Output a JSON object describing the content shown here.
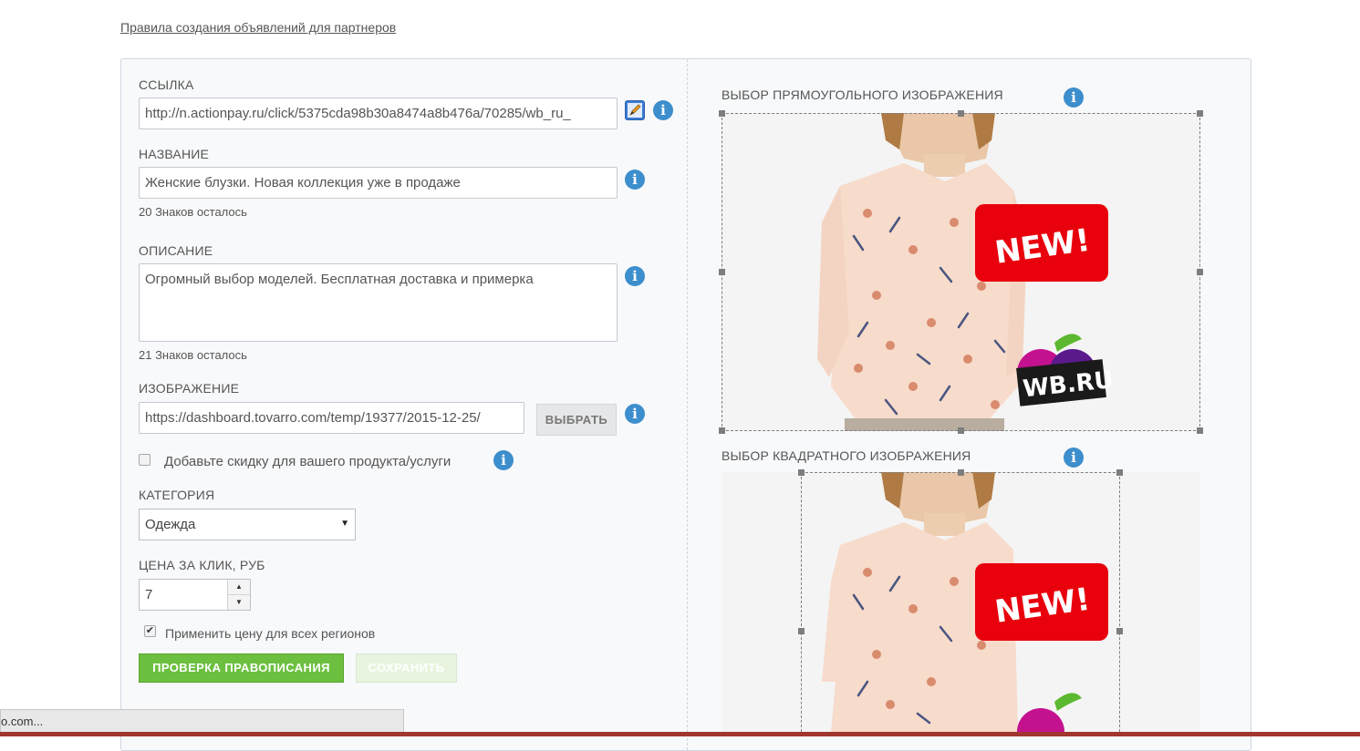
{
  "top_link": "Правила создания объявлений для партнеров",
  "form": {
    "link": {
      "label": "ССЫЛКА",
      "value": "http://n.actionpay.ru/click/5375cda98b30a8474a8b476a/70285/wb_ru_"
    },
    "title": {
      "label": "НАЗВАНИЕ",
      "value": "Женские блузки. Новая коллекция уже в продаже",
      "counter": "20 Знаков осталось"
    },
    "description": {
      "label": "ОПИСАНИЕ",
      "value": "Огромный выбор моделей. Бесплатная доставка и примерка",
      "counter": "21 Знаков осталось"
    },
    "image": {
      "label": "ИЗОБРАЖЕНИЕ",
      "value": "https://dashboard.tovarro.com/temp/19377/2015-12-25/",
      "choose_button": "ВЫБРАТЬ"
    },
    "discount_checkbox": {
      "label": "Добавьте скидку для вашего продукта/услуги",
      "checked": false
    },
    "category": {
      "label": "КАТЕГОРИЯ",
      "selected": "Одежда"
    },
    "price": {
      "label": "ЦЕНА ЗА КЛИК, РУБ",
      "value": "7"
    },
    "all_regions_checkbox": {
      "label": "Применить цену для всех регионов",
      "checked": true
    },
    "spellcheck_button": "ПРОВЕРКА ПРАВОПИСАНИЯ",
    "save_button": "СОХРАНИТЬ"
  },
  "preview": {
    "rect_label": "ВЫБОР ПРЯМОУГОЛЬНОГО ИЗОБРАЖЕНИЯ",
    "square_label": "ВЫБОР КВАДРАТНОГО ИЗОБРАЖЕНИЯ",
    "badge_text": "NEW!",
    "logo_text": "WB.RU"
  },
  "status_bar": "o.com...",
  "info_glyph": "i",
  "icons": [
    "info-icon",
    "pencil-icon",
    "select-arrow-icon",
    "spin-up-icon",
    "spin-down-icon",
    "checkmark-icon"
  ],
  "colors": {
    "primary_green": "#6cbf3f",
    "info_blue": "#3d8ecc",
    "badge_red": "#e8000d",
    "panel_bg": "#f8f9fb"
  }
}
